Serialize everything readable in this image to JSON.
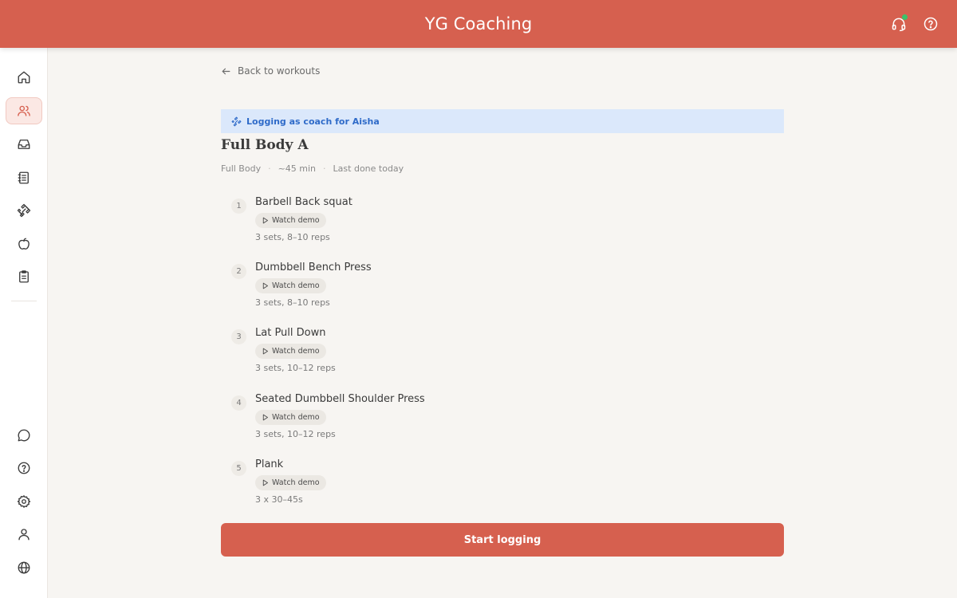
{
  "header": {
    "title": "YG Coaching",
    "actions": [
      {
        "icon": "support-headset-icon",
        "has_status_dot": true,
        "status_color": "#3cc26a"
      },
      {
        "icon": "help-icon"
      }
    ]
  },
  "colors": {
    "brand": "#d6604f",
    "banner_bg": "#dbe8fb",
    "banner_text": "#2f6bc9",
    "page_bg": "#f7f5f2"
  },
  "sidebar": {
    "top_items": [
      {
        "icon": "home-icon",
        "active": false
      },
      {
        "icon": "clients-icon",
        "active": true
      },
      {
        "icon": "inbox-icon",
        "active": false
      },
      {
        "icon": "notebook-icon",
        "active": false
      },
      {
        "icon": "dumbbell-icon",
        "active": false
      },
      {
        "icon": "apple-icon",
        "active": false
      },
      {
        "icon": "clipboard-icon",
        "active": false
      }
    ],
    "bottom_items": [
      {
        "icon": "chat-icon"
      },
      {
        "icon": "help-icon"
      },
      {
        "icon": "settings-icon"
      },
      {
        "icon": "profile-icon"
      },
      {
        "icon": "globe-icon"
      }
    ]
  },
  "main": {
    "back_label": "Back to workouts",
    "banner_text": "Logging as coach for Aisha",
    "workout_title": "Full Body A",
    "meta": {
      "category": "Full Body",
      "duration": "~45 min",
      "last_done": "Last done today"
    },
    "demo_label": "Watch demo",
    "exercises": [
      {
        "number": "1",
        "name": "Barbell Back squat",
        "detail": "3 sets, 8–10 reps"
      },
      {
        "number": "2",
        "name": "Dumbbell Bench Press",
        "detail": "3 sets, 8–10 reps"
      },
      {
        "number": "3",
        "name": "Lat Pull Down",
        "detail": "3 sets, 10–12 reps"
      },
      {
        "number": "4",
        "name": "Seated Dumbbell Shoulder Press",
        "detail": "3 sets, 10–12 reps"
      },
      {
        "number": "5",
        "name": "Plank",
        "detail": "3 x 30–45s"
      }
    ],
    "start_label": "Start logging"
  }
}
